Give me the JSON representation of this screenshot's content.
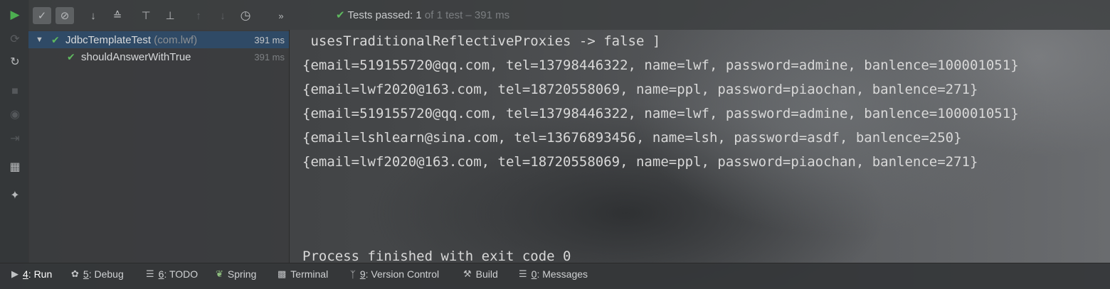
{
  "toolbar": {
    "status_label": "Tests passed:",
    "passed_count": "1",
    "status_total": "of 1 test – 391 ms"
  },
  "tree": {
    "items": [
      {
        "name": "JdbcTemplateTest",
        "package": "(com.lwf)",
        "time": "391 ms"
      },
      {
        "name": "shouldAnswerWithTrue",
        "time": "391 ms"
      }
    ]
  },
  "console": {
    "lines": [
      " usesTraditionalReflectiveProxies -> false ]",
      "{email=519155720@qq.com, tel=13798446322, name=lwf, password=admine, banlence=100001051}",
      "{email=lwf2020@163.com, tel=18720558069, name=ppl, password=piaochan, banlence=271}",
      "{email=519155720@qq.com, tel=13798446322, name=lwf, password=admine, banlence=100001051}",
      "{email=lshlearn@sina.com, tel=13676893456, name=lsh, password=asdf, banlence=250}",
      "{email=lwf2020@163.com, tel=18720558069, name=ppl, password=piaochan, banlence=271}",
      "Process finished with exit code 0"
    ]
  },
  "bottom_tabs": [
    {
      "key": "4",
      "label": ": Run"
    },
    {
      "key": "5",
      "label": ": Debug"
    },
    {
      "key": "6",
      "label": ": TODO"
    },
    {
      "label": "Spring"
    },
    {
      "label": "Terminal"
    },
    {
      "key": "9",
      "label": ": Version Control"
    },
    {
      "label": "Build"
    },
    {
      "key": "0",
      "label": ": Messages"
    }
  ],
  "colors": {
    "pass_green": "#5fb95f",
    "selection_blue": "#2f4a66",
    "run_green": "#4caf50"
  }
}
